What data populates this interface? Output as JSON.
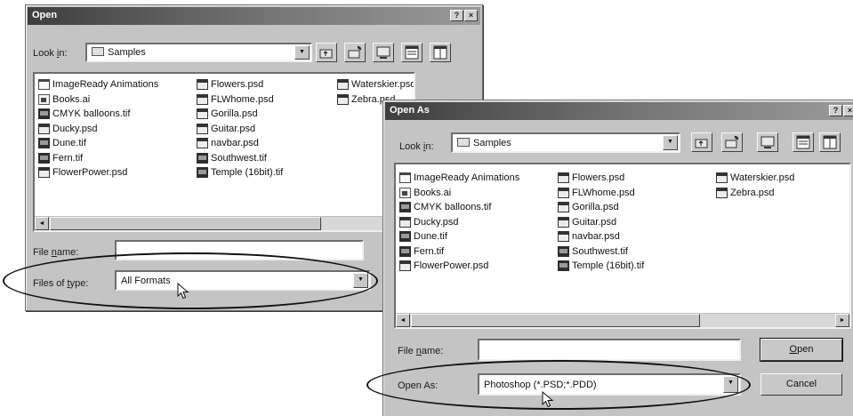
{
  "open_dialog": {
    "title": "Open",
    "help_btn": "?",
    "close_btn": "×",
    "look_in_label_pre": "Look ",
    "look_in_label_key": "i",
    "look_in_label_post": "n:",
    "look_in_value": "Samples",
    "files_col1": [
      "ImageReady Animations",
      "Books.ai",
      "CMYK balloons.tif",
      "Ducky.psd",
      "Dune.tif",
      "Fern.tif",
      "FlowerPower.psd"
    ],
    "files_col2": [
      "Flowers.psd",
      "FLWhome.psd",
      "Gorilla.psd",
      "Guitar.psd",
      "navbar.psd",
      "Southwest.tif",
      "Temple (16bit).tif"
    ],
    "files_col3": [
      "Waterskier.psd",
      "Zebra.psd"
    ],
    "file_name_label_pre": "File ",
    "file_name_label_key": "n",
    "file_name_label_post": "ame:",
    "file_name_value": "",
    "files_of_type_label_pre": "Files of ",
    "files_of_type_label_key": "t",
    "files_of_type_label_post": "ype:",
    "files_of_type_value": "All Formats"
  },
  "open_as_dialog": {
    "title": "Open As",
    "help_btn": "?",
    "close_btn": "×",
    "look_in_label_pre": "Look ",
    "look_in_label_key": "i",
    "look_in_label_post": "n:",
    "look_in_value": "Samples",
    "files_col1": [
      "ImageReady Animations",
      "Books.ai",
      "CMYK balloons.tif",
      "Ducky.psd",
      "Dune.tif",
      "Fern.tif",
      "FlowerPower.psd"
    ],
    "files_col2": [
      "Flowers.psd",
      "FLWhome.psd",
      "Gorilla.psd",
      "Guitar.psd",
      "navbar.psd",
      "Southwest.tif",
      "Temple (16bit).tif"
    ],
    "files_col3": [
      "Waterskier.psd",
      "Zebra.psd"
    ],
    "file_name_label_pre": "File ",
    "file_name_label_key": "n",
    "file_name_label_post": "ame:",
    "file_name_value": "",
    "open_as_label": "Open As:",
    "open_as_value": "Photoshop (*.PSD;*.PDD)",
    "open_button_key": "O",
    "open_button_rest": "pen",
    "cancel_button": "Cancel"
  },
  "icons": {
    "folder": "folder-icon",
    "up_folder": "up-one-level-icon",
    "new_folder": "new-folder-icon",
    "desktop": "desktop-icon",
    "list_view": "list-view-icon",
    "details_view": "details-view-icon",
    "psd": "psd-file-icon",
    "tif": "tif-file-icon",
    "ai": "ai-file-icon"
  },
  "colors": {
    "dialog_face": "#c4c4c4",
    "title_dark": "#3e3e3e",
    "title_light": "#9a9a9a",
    "highlight_ellipse": "#111111"
  }
}
